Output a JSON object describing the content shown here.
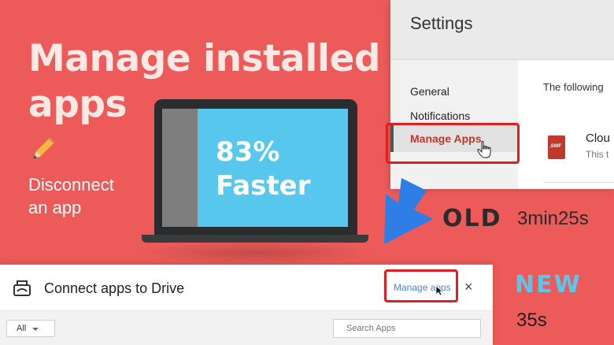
{
  "headline": {
    "line1": "Manage installed",
    "line2": "apps"
  },
  "subtitle": {
    "line1": "Disconnect",
    "line2": "an app"
  },
  "icons": {
    "pencil": "pencil-icon",
    "drive": "drive-connect-icon",
    "close": "close-icon",
    "file": "swf-file-icon",
    "arrow": "down-arrow-icon"
  },
  "laptop": {
    "line1": "83%",
    "line2": "Faster"
  },
  "settings": {
    "title": "Settings",
    "nav": [
      "General",
      "Notifications",
      "Manage Apps"
    ],
    "intro_text": "The following",
    "app_name": "Clou",
    "app_sub": "This t",
    "file_badge": ".SWF"
  },
  "comparison": {
    "old_label": "OLD",
    "old_time": "3min25s",
    "new_label": "NEW",
    "new_time": "35s"
  },
  "drive_dialog": {
    "title": "Connect apps to Drive",
    "manage_link": "Manage apps",
    "close": "×",
    "filter_value": "All",
    "search_placeholder": "Search Apps"
  },
  "colors": {
    "background": "#ec5b59",
    "accent_blue": "#57c7ee",
    "highlight_red": "#e01e1e",
    "link_blue": "#4285f4"
  }
}
